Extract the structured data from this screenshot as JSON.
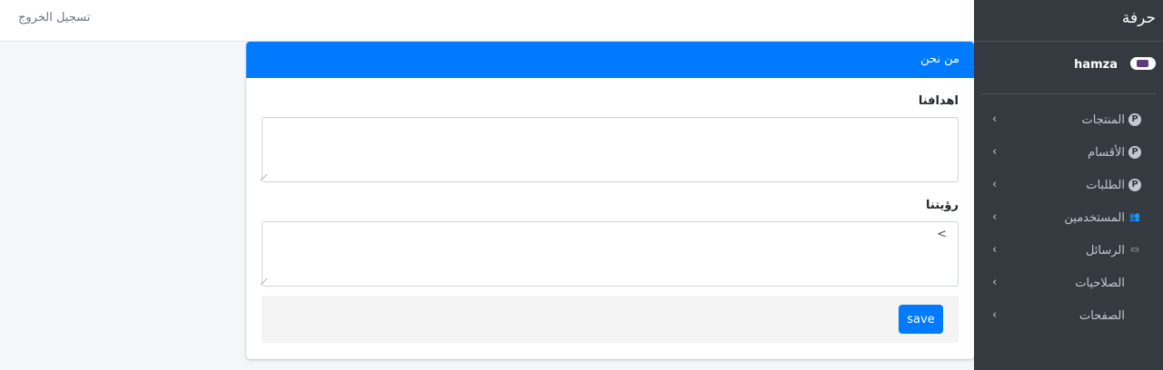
{
  "topbar": {
    "logout_label": "تسجيل الخروج"
  },
  "sidebar": {
    "brand": "حرفة",
    "user": {
      "name": "hamza"
    },
    "items": [
      {
        "label": "المنتجات",
        "icon": "p-circle-icon",
        "glyph": "P"
      },
      {
        "label": "الأقسام",
        "icon": "p-circle-icon",
        "glyph": "P"
      },
      {
        "label": "الطلبات",
        "icon": "p-circle-icon",
        "glyph": "P"
      },
      {
        "label": "المستخدمين",
        "icon": "users-icon",
        "glyph": "👥"
      },
      {
        "label": "الرسائل",
        "icon": "inbox-icon",
        "glyph": "▭"
      },
      {
        "label": "الصلاحيات",
        "icon": "",
        "glyph": ""
      },
      {
        "label": "الصفحات",
        "icon": "",
        "glyph": ""
      }
    ],
    "chevron": "›"
  },
  "card": {
    "title": "من نحن",
    "fields": [
      {
        "label": "اهدافنا",
        "value": ""
      },
      {
        "label": "رؤيتنا",
        "value": ">"
      }
    ],
    "save_label": "save"
  },
  "colors": {
    "primary": "#007bff",
    "sidebar_bg": "#343a40",
    "page_bg": "#f4f6f9"
  }
}
